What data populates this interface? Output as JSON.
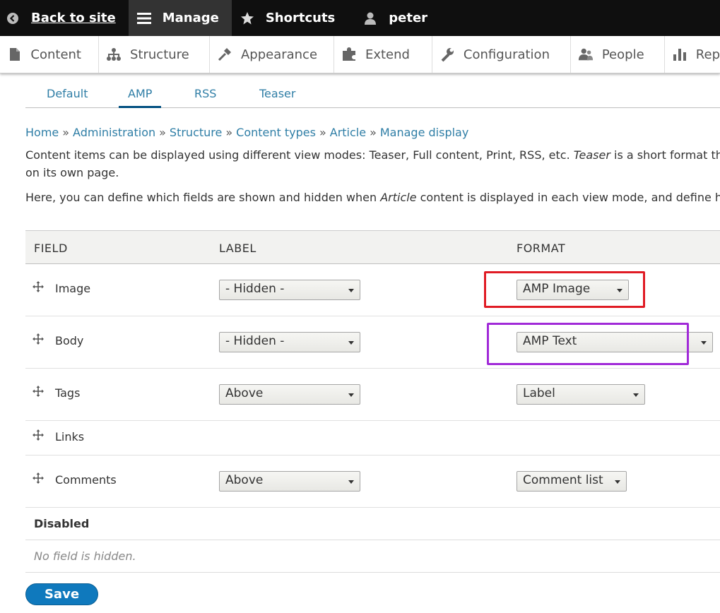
{
  "toolbar": {
    "back": "Back to site",
    "manage": "Manage",
    "shortcuts": "Shortcuts",
    "user": "peter"
  },
  "tray": {
    "items": [
      "Content",
      "Structure",
      "Appearance",
      "Extend",
      "Configuration",
      "People",
      "Rep"
    ]
  },
  "tabs": [
    "Default",
    "AMP",
    "RSS",
    "Teaser"
  ],
  "breadcrumb": [
    "Home",
    "Administration",
    "Structure",
    "Content types",
    "Article",
    "Manage display"
  ],
  "breadcrumb_sep": "»",
  "description": {
    "p1_a": "Content items can be displayed using different view modes: Teaser, Full content, Print, RSS, etc. ",
    "p1_em": "Teaser",
    "p1_b": " is a short format that is",
    "p1_line2": "on its own page.",
    "p2_a": "Here, you can define which fields are shown and hidden when ",
    "p2_em": "Article",
    "p2_b": " content is displayed in each view mode, and define how th"
  },
  "table": {
    "headers": {
      "field": "FIELD",
      "label": "LABEL",
      "format": "FORMAT"
    },
    "rows": [
      {
        "field": "Image",
        "label": "- Hidden -",
        "format": "AMP Image"
      },
      {
        "field": "Body",
        "label": "- Hidden -",
        "format": "AMP Text"
      },
      {
        "field": "Tags",
        "label": "Above",
        "format": "Label"
      },
      {
        "field": "Links",
        "label": "",
        "format": ""
      },
      {
        "field": "Comments",
        "label": "Above",
        "format": "Comment list"
      }
    ],
    "disabled_heading": "Disabled",
    "empty_text": "No field is hidden."
  },
  "save_label": "Save",
  "colors": {
    "link": "#2f7ea6",
    "highlight_red": "#e01b24",
    "highlight_purple": "#a12ad8",
    "button": "#0f79bd"
  }
}
